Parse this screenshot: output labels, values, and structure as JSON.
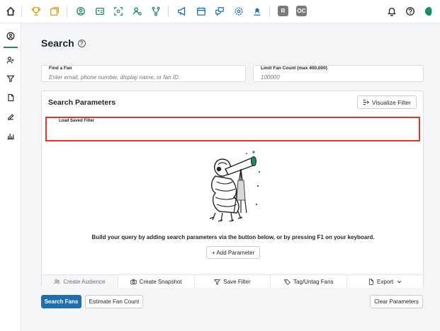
{
  "topbar": {
    "badge_1": "R",
    "badge_2": "OC"
  },
  "page": {
    "title": "Search",
    "help": "?"
  },
  "find_fan": {
    "label": "Find a Fan",
    "placeholder": "Enter email, phone number, display name, or fan ID."
  },
  "limit": {
    "label": "Limit Fan Count (max 400,000)",
    "placeholder": "100000"
  },
  "params": {
    "title": "Search Parameters",
    "visualize_label": "Visualize Filter",
    "saved_filter_label": "Load Saved Filter",
    "empty_text": "Build your query by adding search parameters via the button below, or by pressing F1 on your keyboard.",
    "add_label": "+ Add Parameter"
  },
  "actions": [
    {
      "label": "Create Audience"
    },
    {
      "label": "Create Snapshot"
    },
    {
      "label": "Save Filter"
    },
    {
      "label": "Tag/Untag Fans"
    },
    {
      "label": "Export"
    }
  ],
  "buttons": {
    "search": "Search Fans",
    "estimate": "Estimate Fan Count",
    "clear": "Clear Parameters"
  },
  "colors": {
    "accent": "#1d8a6a",
    "gold": "#d4a017",
    "primary": "#1f6eb0",
    "highlight": "#e0362a"
  }
}
